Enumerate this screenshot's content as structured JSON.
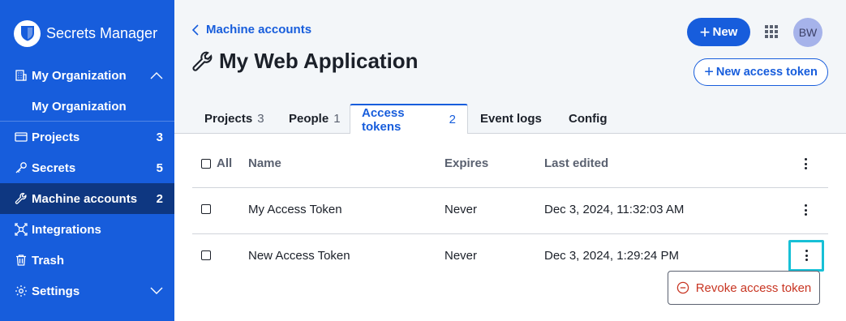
{
  "sidebar": {
    "brand": "Secrets Manager",
    "org": {
      "label": "My Organization",
      "sub_label": "My Organization"
    },
    "items": [
      {
        "label": "Projects",
        "count": "3",
        "icon": "projects-icon"
      },
      {
        "label": "Secrets",
        "count": "5",
        "icon": "key-icon"
      },
      {
        "label": "Machine accounts",
        "count": "2",
        "icon": "wrench-icon"
      },
      {
        "label": "Integrations",
        "count": "",
        "icon": "integrations-icon"
      },
      {
        "label": "Trash",
        "count": "",
        "icon": "trash-icon"
      },
      {
        "label": "Settings",
        "count": "",
        "icon": "gear-icon"
      }
    ]
  },
  "header": {
    "back_label": "Machine accounts",
    "title": "My Web Application",
    "new_button": "New",
    "avatar": "BW",
    "new_token_button": "New access token"
  },
  "tabs": [
    {
      "label": "Projects",
      "count": "3"
    },
    {
      "label": "People",
      "count": "1"
    },
    {
      "label": "Access tokens",
      "count": "2"
    },
    {
      "label": "Event logs",
      "count": ""
    },
    {
      "label": "Config",
      "count": ""
    }
  ],
  "table": {
    "headers": {
      "all": "All",
      "name": "Name",
      "expires": "Expires",
      "last_edited": "Last edited"
    },
    "rows": [
      {
        "name": "My Access Token",
        "expires": "Never",
        "last_edited": "Dec 3, 2024, 11:32:03 AM"
      },
      {
        "name": "New Access Token",
        "expires": "Never",
        "last_edited": "Dec 3, 2024, 1:29:24 PM"
      }
    ]
  },
  "menu": {
    "revoke": "Revoke access token"
  },
  "colors": {
    "brand": "#175ddc",
    "sidebar_active": "#0e3781",
    "danger": "#c83522",
    "focus": "#17c0d6"
  }
}
